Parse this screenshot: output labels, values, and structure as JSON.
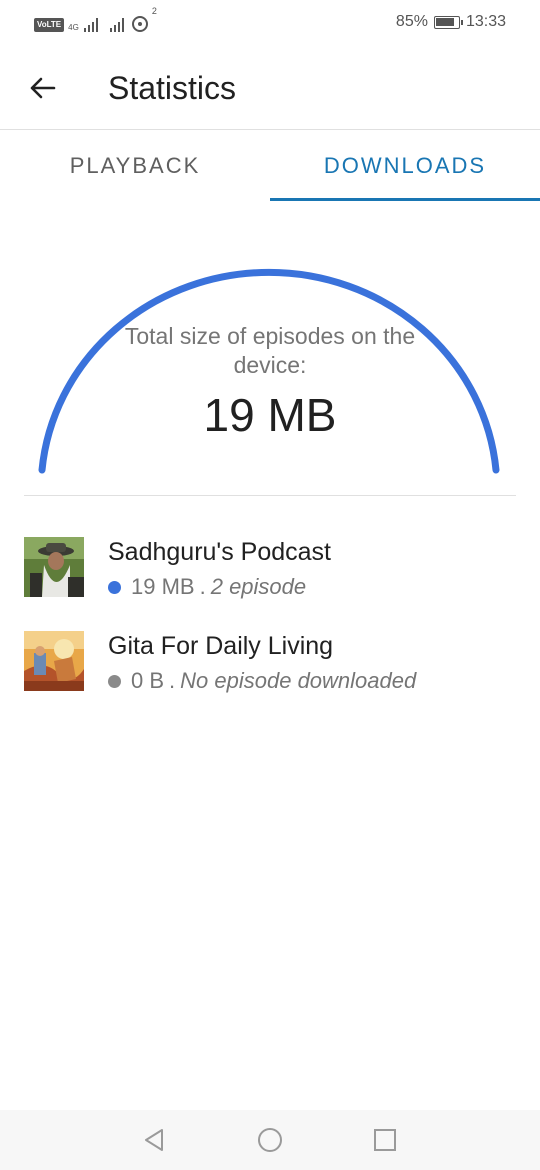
{
  "status_bar": {
    "volte": "VoLTE",
    "network": "4G",
    "hotspot_count": "2",
    "battery": "85%",
    "time": "13:33"
  },
  "toolbar": {
    "back_icon": "arrow-back-icon",
    "title": "Statistics"
  },
  "tabs": [
    {
      "label": "PLAYBACK",
      "active": false
    },
    {
      "label": "DOWNLOADS",
      "active": true
    }
  ],
  "gauge": {
    "label": "Total size of episodes on the device:",
    "value": "19 MB",
    "fill_fraction": 1.0,
    "color": "#3a72db"
  },
  "podcasts": [
    {
      "title": "Sadhguru's Podcast",
      "size": "19 MB",
      "episodes": "2 episode",
      "dot_color": "#3a72db"
    },
    {
      "title": "Gita For Daily Living",
      "size": "0 B",
      "episodes": "No episode downloaded",
      "dot_color": "#8a8a8a"
    }
  ],
  "nav_bar": {
    "back": "triangle-back-icon",
    "home": "circle-home-icon",
    "recents": "square-recents-icon"
  }
}
